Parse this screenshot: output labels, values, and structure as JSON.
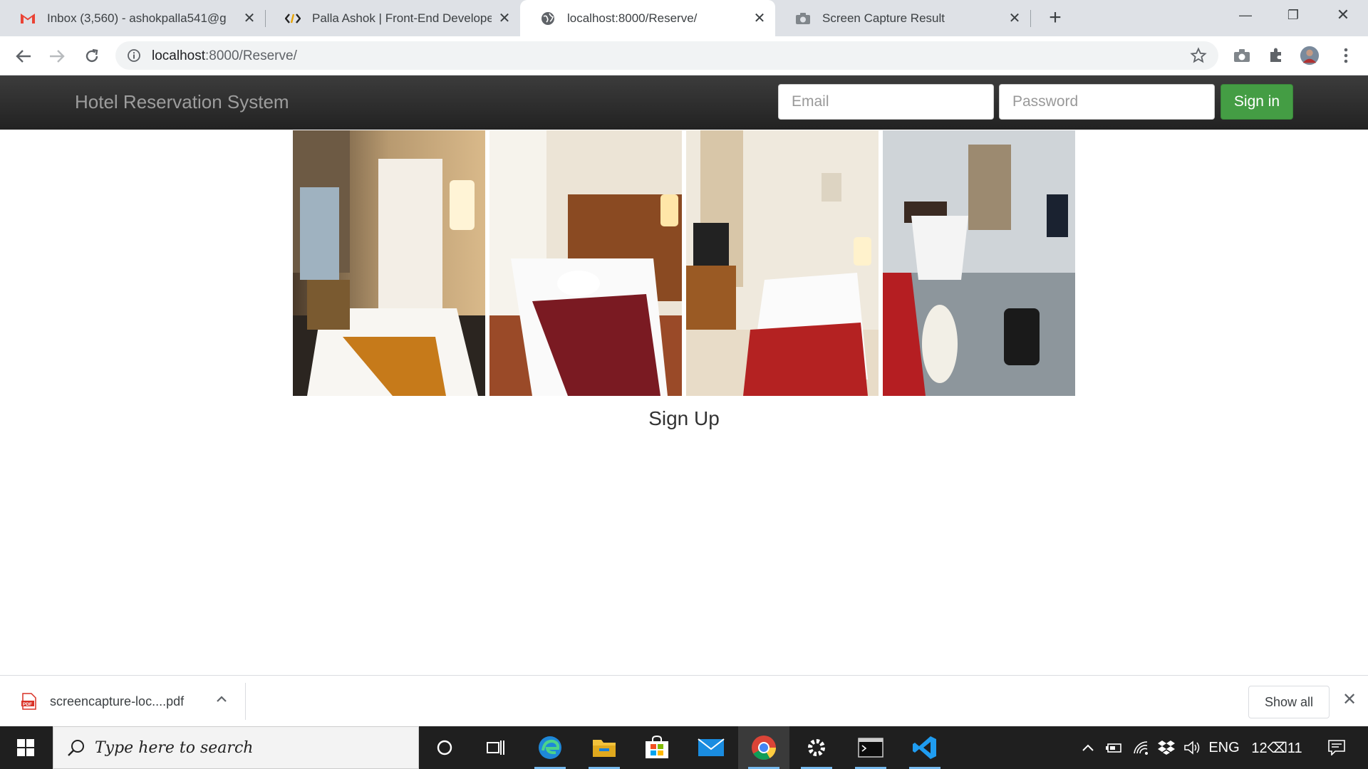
{
  "browser": {
    "tabs": [
      {
        "title": "Inbox (3,560) - ashokpalla541@g",
        "icon": "gmail-icon"
      },
      {
        "title": "Palla Ashok | Front-End Develope",
        "icon": "code-icon"
      },
      {
        "title": "localhost:8000/Reserve/",
        "icon": "globe-icon"
      },
      {
        "title": "Screen Capture Result",
        "icon": "camera-icon"
      }
    ],
    "url_host": "localhost",
    "url_path": ":8000/Reserve/"
  },
  "navbar": {
    "brand": "Hotel Reservation System",
    "email_placeholder": "Email",
    "password_placeholder": "Password",
    "signin_label": "Sign in"
  },
  "main": {
    "signup_text": "Sign Up"
  },
  "downloads": {
    "file_name": "screencapture-loc....pdf",
    "file_type": "PDF",
    "show_all_label": "Show all"
  },
  "taskbar": {
    "search_placeholder": "Type here to search",
    "language": "ENG",
    "time": "12⌫11"
  },
  "colors": {
    "navbar_bg": "#222222",
    "signin_bg": "#449d44",
    "brand_text": "#9d9d9d",
    "taskbar_bg": "#1f1f1f"
  }
}
